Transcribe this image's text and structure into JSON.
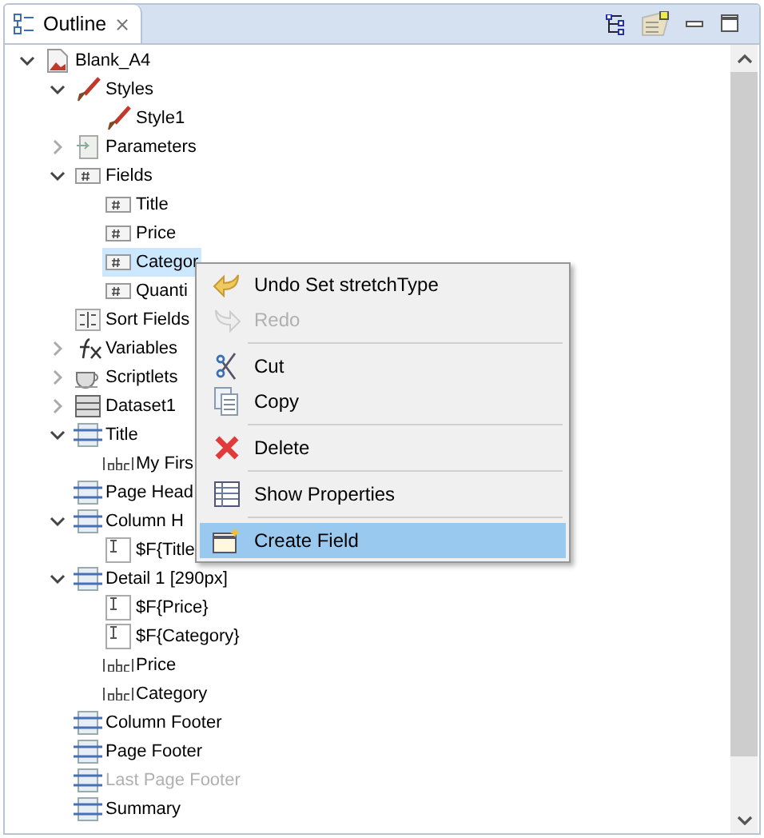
{
  "tab": {
    "title": "Outline",
    "close": "⨯"
  },
  "tree": [
    {
      "label": "Blank_A4",
      "kind": "report",
      "expanded": true,
      "children": [
        {
          "label": "Styles",
          "kind": "styles",
          "expanded": true,
          "children": [
            {
              "label": "Style1",
              "kind": "style"
            }
          ]
        },
        {
          "label": "Parameters",
          "kind": "parameters",
          "expanded": false
        },
        {
          "label": "Fields",
          "kind": "field",
          "expanded": true,
          "children": [
            {
              "label": "Title",
              "kind": "field",
              "selected": false
            },
            {
              "label": "Price",
              "kind": "field",
              "selected": false
            },
            {
              "label": "Categor",
              "kind": "field",
              "selected": true
            },
            {
              "label": "Quanti",
              "kind": "field",
              "selected": false
            }
          ]
        },
        {
          "label": "Sort Fields",
          "kind": "sort"
        },
        {
          "label": "Variables",
          "kind": "variables",
          "expanded": false
        },
        {
          "label": "Scriptlets",
          "kind": "scriptlets",
          "expanded": false
        },
        {
          "label": "Dataset1",
          "kind": "dataset",
          "expanded": false
        },
        {
          "label": "Title",
          "kind": "band",
          "expanded": true,
          "children": [
            {
              "label": "My Firs",
              "kind": "label"
            }
          ]
        },
        {
          "label": "Page Head",
          "kind": "band"
        },
        {
          "label": "Column H",
          "kind": "band",
          "expanded": true,
          "children": [
            {
              "label": "$F{Title",
              "kind": "textfield"
            }
          ]
        },
        {
          "label": "Detail 1 [290px]",
          "kind": "band",
          "expanded": true,
          "children": [
            {
              "label": "$F{Price}",
              "kind": "textfield"
            },
            {
              "label": "$F{Category}",
              "kind": "textfield"
            },
            {
              "label": "Price",
              "kind": "label"
            },
            {
              "label": "Category",
              "kind": "label"
            }
          ]
        },
        {
          "label": "Column Footer",
          "kind": "band",
          "disabled": false
        },
        {
          "label": "Page Footer",
          "kind": "band",
          "disabled": false
        },
        {
          "label": "Last Page Footer",
          "kind": "band",
          "disabled": true
        },
        {
          "label": "Summary",
          "kind": "band",
          "disabled": false
        }
      ]
    }
  ],
  "context_menu": [
    {
      "kind": "undo",
      "label": "Undo Set stretchType",
      "disabled": false,
      "selected": false
    },
    {
      "kind": "redo",
      "label": "Redo",
      "disabled": true,
      "selected": false
    },
    {
      "kind": "separator"
    },
    {
      "kind": "cut",
      "label": "Cut",
      "disabled": false,
      "selected": false
    },
    {
      "kind": "copy",
      "label": "Copy",
      "disabled": false,
      "selected": false
    },
    {
      "kind": "separator"
    },
    {
      "kind": "delete",
      "label": "Delete",
      "disabled": false,
      "selected": false
    },
    {
      "kind": "separator"
    },
    {
      "kind": "properties",
      "label": "Show Properties",
      "disabled": false,
      "selected": false
    },
    {
      "kind": "separator"
    },
    {
      "kind": "create",
      "label": "Create Field",
      "disabled": false,
      "selected": true
    }
  ]
}
